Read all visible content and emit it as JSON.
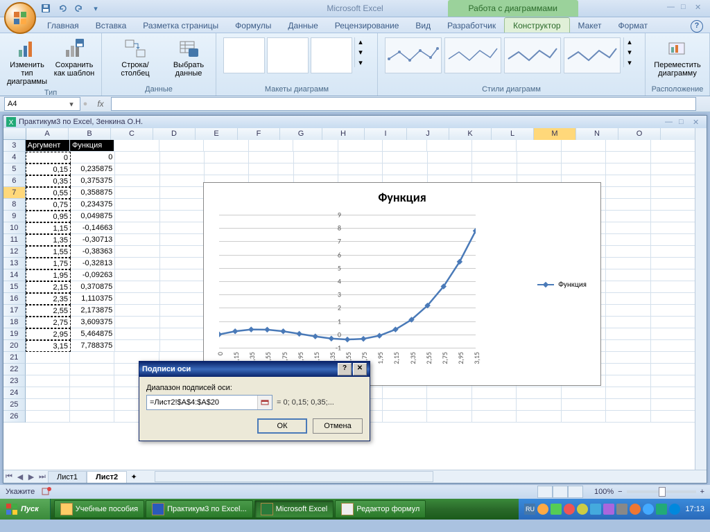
{
  "app": {
    "title": "Microsoft Excel",
    "context_title": "Работа с диаграммами"
  },
  "ribbon": {
    "tabs": [
      "Главная",
      "Вставка",
      "Разметка страницы",
      "Формулы",
      "Данные",
      "Рецензирование",
      "Вид",
      "Разработчик"
    ],
    "ctx_tabs": [
      "Конструктор",
      "Макет",
      "Формат"
    ],
    "active_ctx": "Конструктор",
    "groups": {
      "type": {
        "label": "Тип",
        "btn1": "Изменить тип диаграммы",
        "btn2": "Сохранить как шаблон"
      },
      "data": {
        "label": "Данные",
        "btn1": "Строка/столбец",
        "btn2": "Выбрать данные"
      },
      "layouts": {
        "label": "Макеты диаграмм"
      },
      "styles": {
        "label": "Стили диаграмм"
      },
      "location": {
        "label": "Расположение",
        "btn1": "Переместить диаграмму"
      }
    }
  },
  "namebox": "A4",
  "workbook_title": "Практикум3 по Excel, Зенкина О.Н.",
  "columns": [
    "A",
    "B",
    "C",
    "D",
    "E",
    "F",
    "G",
    "H",
    "I",
    "J",
    "K",
    "L",
    "M",
    "N",
    "O"
  ],
  "sel_col_idx": 12,
  "header_row": 3,
  "headers": {
    "a": "Аргумент",
    "b": "Функция"
  },
  "table_rows": [
    {
      "r": 4,
      "a": "0",
      "b": "0"
    },
    {
      "r": 5,
      "a": "0,15",
      "b": "0,235875"
    },
    {
      "r": 6,
      "a": "0,35",
      "b": "0,375375"
    },
    {
      "r": 7,
      "a": "0,55",
      "b": "0,358875"
    },
    {
      "r": 8,
      "a": "0,75",
      "b": "0,234375"
    },
    {
      "r": 9,
      "a": "0,95",
      "b": "0,049875"
    },
    {
      "r": 10,
      "a": "1,15",
      "b": "-0,14663"
    },
    {
      "r": 11,
      "a": "1,35",
      "b": "-0,30713"
    },
    {
      "r": 12,
      "a": "1,55",
      "b": "-0,38363"
    },
    {
      "r": 13,
      "a": "1,75",
      "b": "-0,32813"
    },
    {
      "r": 14,
      "a": "1,95",
      "b": "-0,09263"
    },
    {
      "r": 15,
      "a": "2,15",
      "b": "0,370875"
    },
    {
      "r": 16,
      "a": "2,35",
      "b": "1,110375"
    },
    {
      "r": 17,
      "a": "2,55",
      "b": "2,173875"
    },
    {
      "r": 18,
      "a": "2,75",
      "b": "3,609375"
    },
    {
      "r": 19,
      "a": "2,95",
      "b": "5,464875"
    },
    {
      "r": 20,
      "a": "3,15",
      "b": "7,788375"
    }
  ],
  "blank_rows": [
    21,
    22,
    23,
    24,
    25,
    26
  ],
  "active_cell": "M7",
  "sheets": {
    "tabs": [
      "Лист1",
      "Лист2"
    ],
    "active": "Лист2"
  },
  "status": "Укажите",
  "zoom": "100%",
  "dialog": {
    "title": "Подписи оси",
    "label": "Диапазон подписей оси:",
    "value": "=Лист2!$A$4:$A$20",
    "preview": "= 0; 0,15; 0,35;...",
    "ok": "ОК",
    "cancel": "Отмена"
  },
  "chart_data": {
    "type": "line",
    "title": "Функция",
    "series": [
      {
        "name": "Функция",
        "x": [
          0,
          0.15,
          0.35,
          0.55,
          0.75,
          0.95,
          1.15,
          1.35,
          1.55,
          1.75,
          1.95,
          2.15,
          2.35,
          2.55,
          2.75,
          2.95,
          3.15
        ],
        "y": [
          0,
          0.235875,
          0.375375,
          0.358875,
          0.234375,
          0.049875,
          -0.14663,
          -0.30713,
          -0.38363,
          -0.32813,
          -0.09263,
          0.370875,
          1.110375,
          2.173875,
          3.609375,
          5.464875,
          7.788375
        ]
      }
    ],
    "xticks": [
      "0",
      "0,15",
      "0,35",
      "0,55",
      "0,75",
      "0,95",
      "1,15",
      "1,35",
      "1,55",
      "1,75",
      "1,95",
      "2,15",
      "2,35",
      "2,55",
      "2,75",
      "2,95",
      "3,15"
    ],
    "yticks": [
      -1,
      0,
      1,
      2,
      3,
      4,
      5,
      6,
      7,
      8,
      9
    ],
    "ylim": [
      -1,
      9
    ],
    "legend": "Функция"
  },
  "taskbar": {
    "start": "Пуск",
    "items": [
      {
        "label": "Учебные пособия",
        "ico": "folder"
      },
      {
        "label": "Практикум3 по Excel...",
        "ico": "word"
      },
      {
        "label": "Microsoft Excel",
        "ico": "excel",
        "active": true
      },
      {
        "label": "Редактор формул",
        "ico": "equation"
      }
    ],
    "lang": "RU",
    "clock": "17:13"
  }
}
